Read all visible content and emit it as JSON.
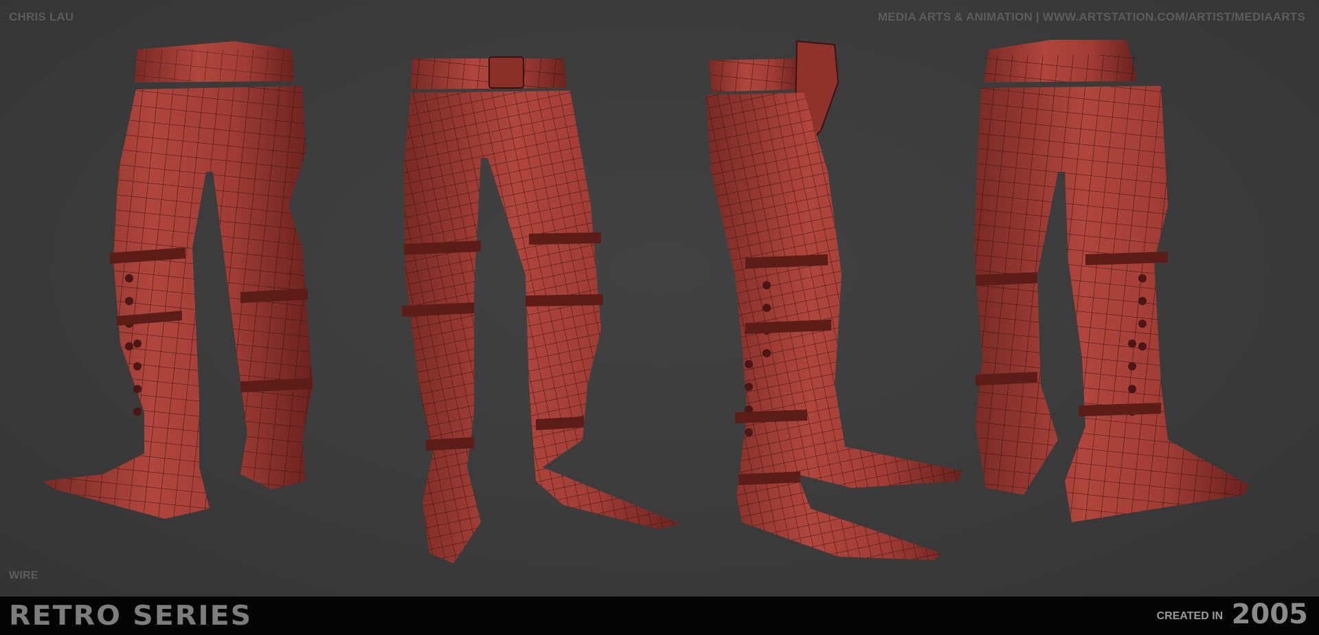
{
  "header": {
    "artist": "CHRIS LAU",
    "credit": "MEDIA ARTS & ANIMATION | WWW.ARTSTATION.COM/ARTIST/MEDIAARTS"
  },
  "viewport": {
    "view_label": "WIRE",
    "views": [
      "back-three-quarter-view",
      "front-view",
      "side-view",
      "back-view"
    ],
    "material_color": "#a8413a",
    "wire_color": "#3a1210",
    "background_color": "#3c3c3c"
  },
  "footer": {
    "series_title": "RETRO SERIES",
    "created_label": "CREATED IN",
    "created_year": "2005"
  }
}
